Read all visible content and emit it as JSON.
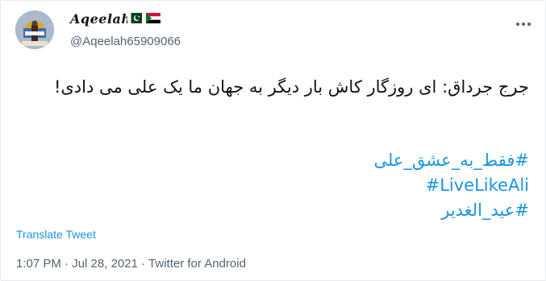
{
  "tweet": {
    "display_name": "Aqeelah",
    "handle": "@Aqeelah65909066",
    "flags": [
      "pakistan-flag",
      "sudan-flag"
    ],
    "text": "جرج جرداق: ای روزگار کاش بار دیگر به جهان ما یک علی می دادی!",
    "hashtags": [
      "#فقط_به_عشق_علی",
      "#LiveLikeAli",
      "#عید_الغدیر"
    ],
    "translate_label": "Translate Tweet",
    "time": "1:07 PM",
    "date": "Jul 28, 2021",
    "source": "Twitter for Android",
    "separator": "·"
  },
  "colors": {
    "link": "#1b95e0",
    "secondary_text": "#536471",
    "primary_text": "#0f1419",
    "border": "#e6ecf0"
  }
}
